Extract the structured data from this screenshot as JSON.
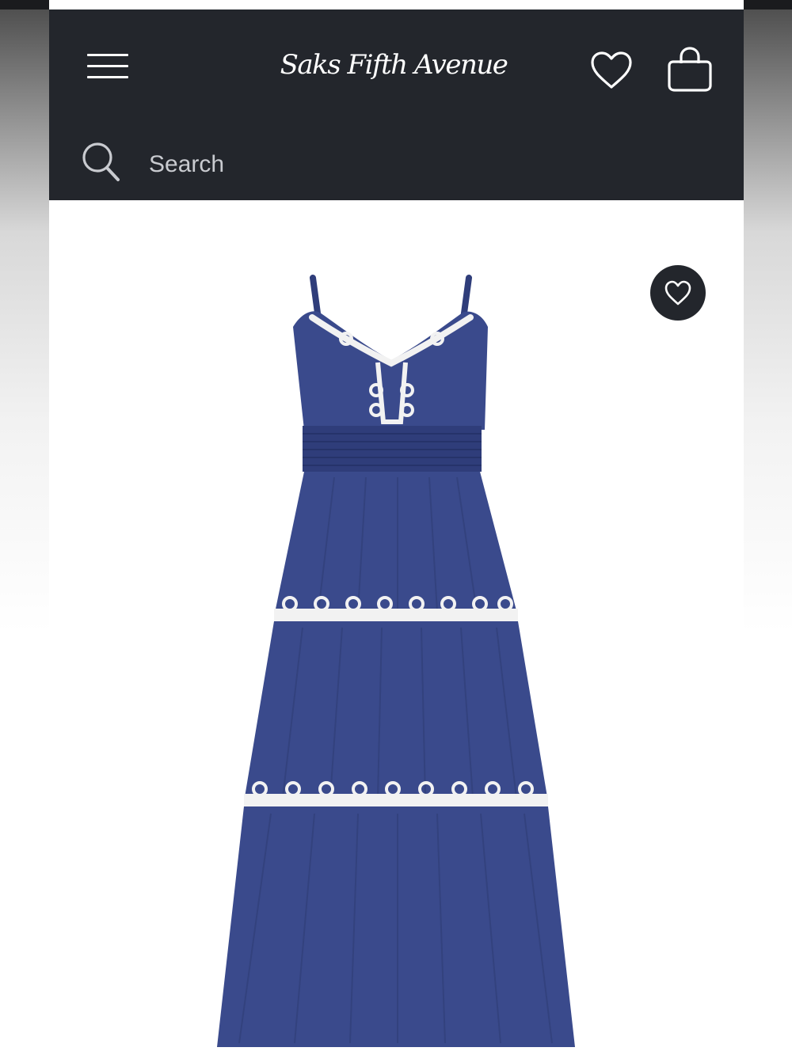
{
  "header": {
    "logo_text": "Saks Fifth Avenue",
    "menu_icon": "hamburger-menu-icon",
    "wishlist_icon": "heart-outline-icon",
    "bag_icon": "shopping-bag-icon"
  },
  "search": {
    "placeholder": "Search",
    "icon": "search-icon"
  },
  "product": {
    "image_alt": "Navy tiered midi dress with white scalloped trim",
    "favorite_icon": "heart-outline-icon"
  },
  "colors": {
    "header_bg": "#23262c",
    "dress_navy": "#3a4a8c",
    "trim_white": "#f2f2f2"
  }
}
